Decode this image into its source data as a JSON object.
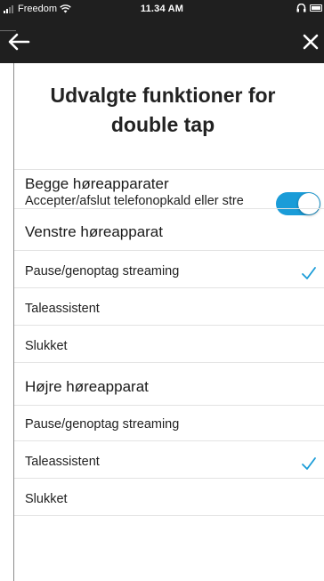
{
  "status_bar": {
    "carrier": "Freedom",
    "time": "11.34 AM"
  },
  "page": {
    "title": "Udvalgte funktioner for double tap"
  },
  "sections": {
    "both": {
      "heading": "Begge høreapparater",
      "toggle_label": "Accepter/afslut telefonopkald eller stre",
      "toggle_on": true
    },
    "left": {
      "heading": "Venstre høreapparat",
      "options": [
        {
          "label": "Pause/genoptag streaming",
          "selected": true
        },
        {
          "label": "Taleassistent",
          "selected": false
        },
        {
          "label": "Slukket",
          "selected": false
        }
      ]
    },
    "right": {
      "heading": "Højre høreapparat",
      "options": [
        {
          "label": "Pause/genoptag streaming",
          "selected": false
        },
        {
          "label": "Taleassistent",
          "selected": true
        },
        {
          "label": "Slukket",
          "selected": false
        }
      ]
    }
  },
  "colors": {
    "accent": "#1a9cd8",
    "top_bar": "#1f1f1f"
  },
  "icons": {
    "back": "arrow-left-icon",
    "close": "close-icon",
    "check": "checkmark-icon",
    "wifi": "wifi-icon",
    "signal": "signal-icon",
    "battery": "battery-icon",
    "hearing": "hearing-aid-icon"
  }
}
